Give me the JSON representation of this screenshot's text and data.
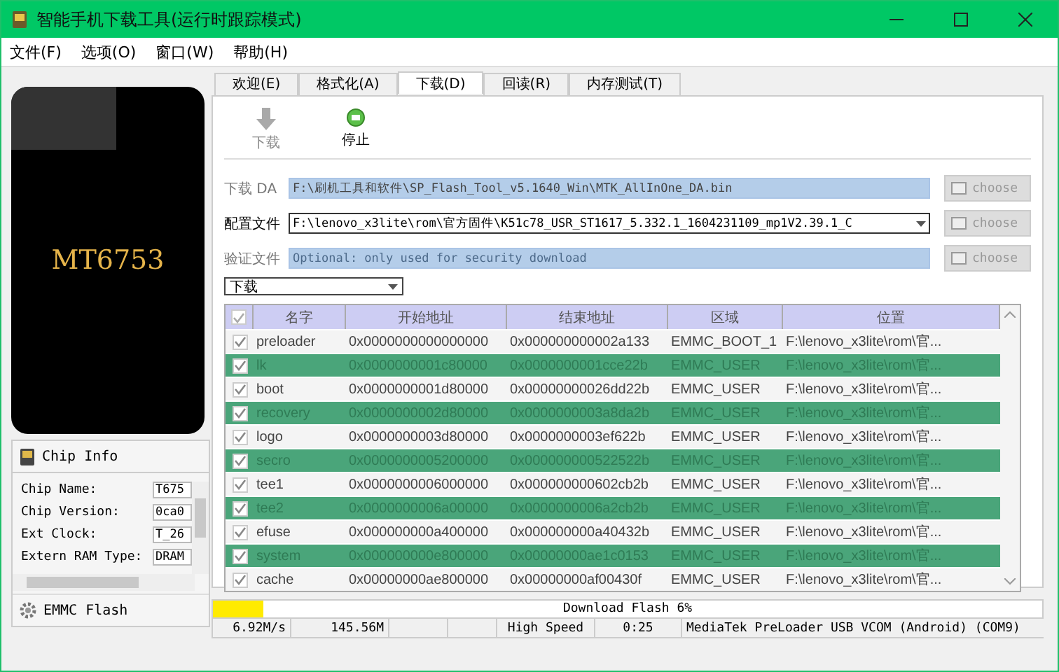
{
  "window": {
    "title": "智能手机下载工具(运行时跟踪模式)"
  },
  "menu": [
    "文件(F)",
    "选项(O)",
    "窗口(W)",
    "帮助(H)"
  ],
  "phone": {
    "label": "MT6753"
  },
  "chip_info": {
    "title": "Chip Info",
    "fields": [
      {
        "label": "Chip Name:",
        "value": "T675"
      },
      {
        "label": "Chip Version:",
        "value": "0ca0"
      },
      {
        "label": "Ext Clock:",
        "value": "T_26"
      },
      {
        "label": "Extern RAM Type:",
        "value": "DRAM"
      }
    ],
    "footer": "EMMC Flash"
  },
  "tabs": [
    {
      "label": "欢迎(E)",
      "selected": false
    },
    {
      "label": "格式化(A)",
      "selected": false
    },
    {
      "label": "下载(D)",
      "selected": true
    },
    {
      "label": "回读(R)",
      "selected": false
    },
    {
      "label": "内存测试(T)",
      "selected": false
    }
  ],
  "toolbar": [
    {
      "kind": "download",
      "label": "下载",
      "disabled": true
    },
    {
      "kind": "stop",
      "label": "停止",
      "disabled": false
    }
  ],
  "files": [
    {
      "label": "下载 DA",
      "kind": "text",
      "value": "F:\\刷机工具和软件\\SP_Flash_Tool_v5.1640_Win\\MTK_AllInOne_DA.bin",
      "disabled": true,
      "button": "choose"
    },
    {
      "label": "配置文件",
      "kind": "combo",
      "value": "F:\\lenovo_x3lite\\rom\\官方固件\\K51c78_USR_ST1617_5.332.1_1604231109_mp1V2.39.1_C",
      "disabled": false,
      "button": "choose"
    },
    {
      "label": "验证文件",
      "kind": "text",
      "placeholder": "Optional: only used for security download",
      "disabled": true,
      "button": "choose"
    }
  ],
  "mode": {
    "value": "下载"
  },
  "table": {
    "header_checked": true,
    "columns": [
      "名字",
      "开始地址",
      "结束地址",
      "区域",
      "位置"
    ],
    "rows": [
      {
        "checked": true,
        "selected": false,
        "cells": [
          "preloader",
          "0x0000000000000000",
          "0x000000000002a133",
          "EMMC_BOOT_1",
          "F:\\lenovo_x3lite\\rom\\官..."
        ]
      },
      {
        "checked": true,
        "selected": true,
        "cells": [
          "lk",
          "0x0000000001c80000",
          "0x0000000001cce22b",
          "EMMC_USER",
          "F:\\lenovo_x3lite\\rom\\官..."
        ]
      },
      {
        "checked": true,
        "selected": false,
        "cells": [
          "boot",
          "0x0000000001d80000",
          "0x00000000026dd22b",
          "EMMC_USER",
          "F:\\lenovo_x3lite\\rom\\官..."
        ]
      },
      {
        "checked": true,
        "selected": true,
        "cells": [
          "recovery",
          "0x0000000002d80000",
          "0x0000000003a8da2b",
          "EMMC_USER",
          "F:\\lenovo_x3lite\\rom\\官..."
        ]
      },
      {
        "checked": true,
        "selected": false,
        "cells": [
          "logo",
          "0x0000000003d80000",
          "0x0000000003ef622b",
          "EMMC_USER",
          "F:\\lenovo_x3lite\\rom\\官..."
        ]
      },
      {
        "checked": true,
        "selected": true,
        "cells": [
          "secro",
          "0x0000000005200000",
          "0x000000000522522b",
          "EMMC_USER",
          "F:\\lenovo_x3lite\\rom\\官..."
        ]
      },
      {
        "checked": true,
        "selected": false,
        "cells": [
          "tee1",
          "0x0000000006000000",
          "0x000000000602cb2b",
          "EMMC_USER",
          "F:\\lenovo_x3lite\\rom\\官..."
        ]
      },
      {
        "checked": true,
        "selected": true,
        "cells": [
          "tee2",
          "0x0000000006a00000",
          "0x0000000006a2cb2b",
          "EMMC_USER",
          "F:\\lenovo_x3lite\\rom\\官..."
        ]
      },
      {
        "checked": true,
        "selected": false,
        "cells": [
          "efuse",
          "0x000000000a400000",
          "0x000000000a40432b",
          "EMMC_USER",
          "F:\\lenovo_x3lite\\rom\\官..."
        ]
      },
      {
        "checked": true,
        "selected": true,
        "cells": [
          "system",
          "0x000000000e800000",
          "0x00000000ae1c0153",
          "EMMC_USER",
          "F:\\lenovo_x3lite\\rom\\官..."
        ]
      },
      {
        "checked": true,
        "selected": false,
        "cells": [
          "cache",
          "0x00000000ae800000",
          "0x00000000af00430f",
          "EMMC_USER",
          "F:\\lenovo_x3lite\\rom\\官..."
        ]
      }
    ]
  },
  "progress": {
    "label": "Download Flash 6%",
    "level": 0.06
  },
  "status_bar": [
    {
      "kind": "text",
      "text": "6.92M/s"
    },
    {
      "kind": "text",
      "text": "145.56M"
    },
    {
      "kind": "blank"
    },
    {
      "kind": "blank"
    },
    {
      "kind": "text",
      "text": "High Speed"
    },
    {
      "kind": "text",
      "text": "0:25"
    },
    {
      "kind": "text",
      "text": "MediaTek PreLoader USB VCOM (Android) (COM9)"
    }
  ]
}
